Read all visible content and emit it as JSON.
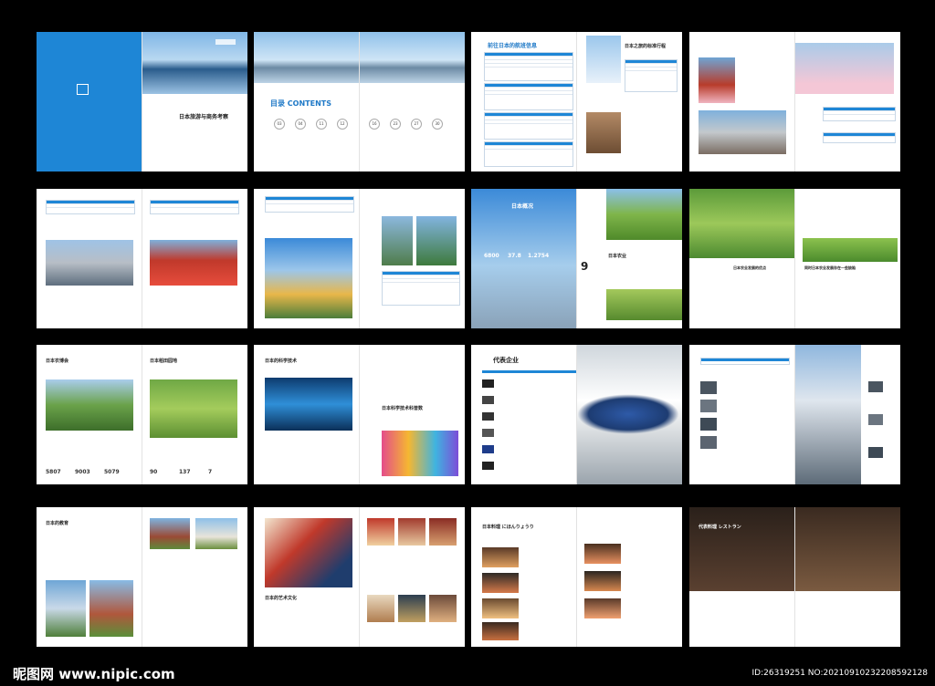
{
  "brochure": {
    "cover_title": "日本旅游与商务考察",
    "contents_title": "目录 CONTENTS",
    "toc_numbers": [
      "03",
      "04",
      "11",
      "12",
      "16",
      "23",
      "27",
      "30"
    ],
    "flight_info_title": "前往日本的航班信息",
    "itinerary_title": "日本之旅的标准行程",
    "overview_title": "日本概况",
    "overview_stats": [
      "6800",
      "37.8",
      "1.2754"
    ],
    "overview_big": "9",
    "agri_title": "日本农业",
    "agri_adv_title": "日本农业发展的优点",
    "agri_prob_title": "同时日本农业发展存在一些缺陷",
    "expo_title": "日本农博会",
    "rice_title": "日本稻田园地",
    "expo_stats": [
      "5807",
      "9003",
      "5079",
      "90",
      "137",
      "7"
    ],
    "sci_title": "日本的科学技术",
    "sci_title2": "日本科学技术科普数",
    "enterprise_title": "代表企业",
    "edu_title": "日本的教育",
    "art_title": "日本的艺术文化",
    "cuisine_title": "日本料理 にほんりょうり",
    "restaurant_title": "代表料理 レストラン"
  },
  "footer": {
    "watermark": "昵图网 www.nipic.com",
    "id_line": "ID:26319251 NO:20210910232208592128"
  },
  "colors": {
    "accent": "#1e86d6",
    "background": "#000000"
  }
}
